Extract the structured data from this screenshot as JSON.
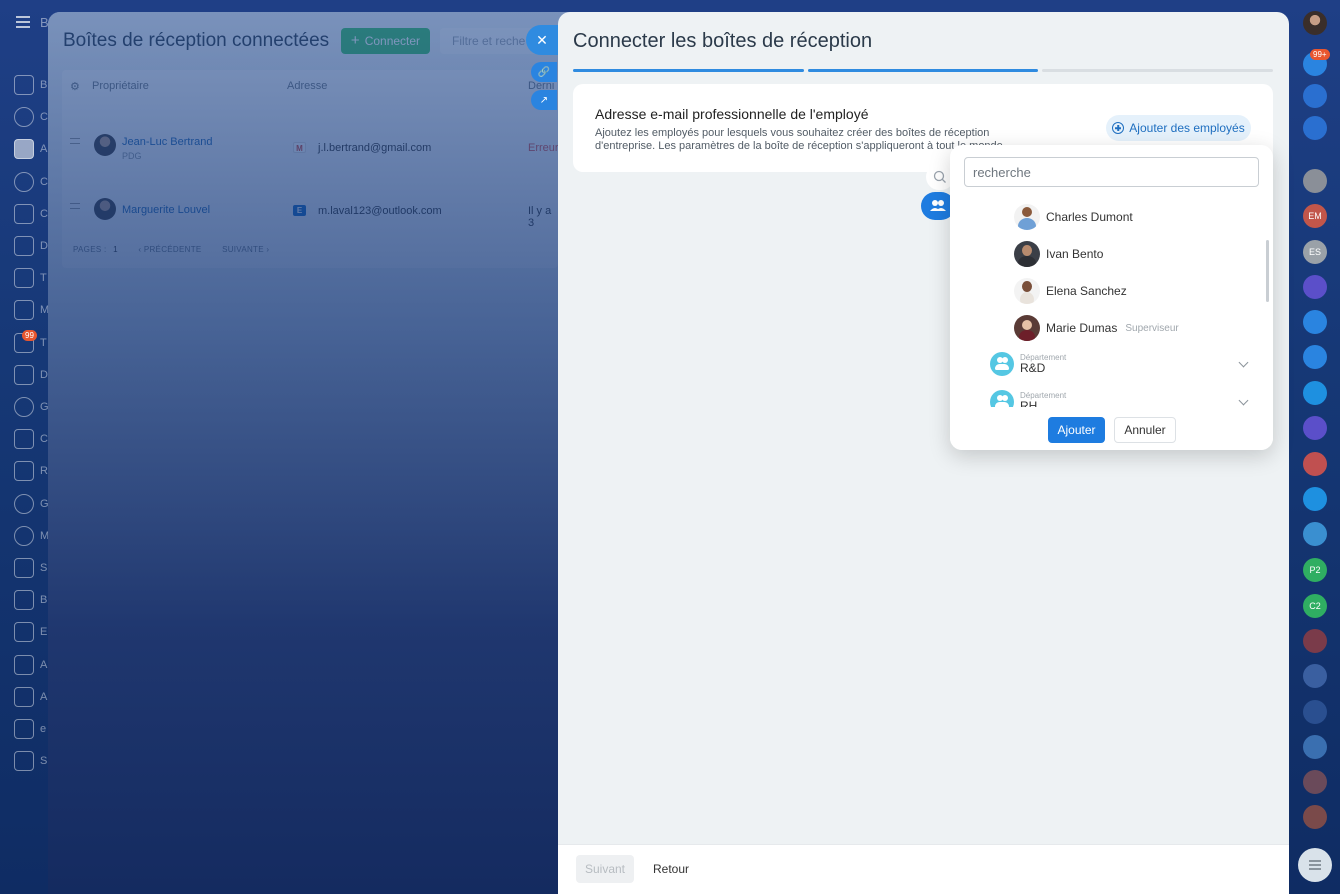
{
  "background_page": {
    "title": "Boîtes de réception connectées",
    "connect_label": "Connecter",
    "filter_placeholder": "Filtre et reche",
    "columns": [
      "Propriétaire",
      "Adresse",
      "Derni"
    ],
    "rows": [
      {
        "name": "Jean-Luc Bertrand",
        "role": "PDG",
        "email": "j.l.bertrand@gmail.com",
        "status": "Erreur",
        "provider": "M"
      },
      {
        "name": "Marguerite Louvel",
        "role": "",
        "email": "m.laval123@outlook.com",
        "status": "Il y a 3",
        "provider": "E"
      }
    ],
    "pager": {
      "pages_label": "PAGES :",
      "page": "1",
      "prev": "PRÉCÉDENTE",
      "next": "SUIVANTE"
    }
  },
  "left_nav": {
    "labels": [
      "B",
      "C",
      "A",
      "C",
      "C",
      "D",
      "T",
      "M",
      "T",
      "D",
      "G",
      "C",
      "R",
      "G",
      "M",
      "S",
      "B",
      "E",
      "A",
      "A",
      "e",
      "S"
    ],
    "badges": {
      "tasks": "99"
    }
  },
  "slider": {
    "title": "Connecter les boîtes de réception",
    "steps": [
      true,
      true,
      false
    ],
    "card": {
      "title": "Adresse e-mail professionnelle de l'employé",
      "description": "Ajoutez les employés pour lesquels vous souhaitez créer des boîtes de réception d'entreprise. Les paramètres de la boîte de réception s'appliqueront à tout le monde.",
      "add_employees_label": "Ajouter des employés"
    },
    "footer": {
      "next_label": "Suivant",
      "back_label": "Retour"
    }
  },
  "popup": {
    "search_placeholder": "recherche",
    "people": [
      {
        "name": "Charles Dumont",
        "role": ""
      },
      {
        "name": "Ivan Bento",
        "role": ""
      },
      {
        "name": "Elena Sanchez",
        "role": ""
      },
      {
        "name": "Marie Dumas",
        "role": "Superviseur"
      }
    ],
    "departments": [
      {
        "label": "Département",
        "name": "R&D"
      },
      {
        "label": "Département",
        "name": "RH"
      }
    ],
    "add_label": "Ajouter",
    "cancel_label": "Annuler"
  },
  "right_rail": {
    "notifications_badge": "99+",
    "initials": [
      "EM",
      "ES",
      "P2",
      "C2"
    ]
  },
  "colors": {
    "accent": "#1e7ce0",
    "connect_green": "#3bc06b",
    "dept_cyan": "#55c7e3"
  }
}
